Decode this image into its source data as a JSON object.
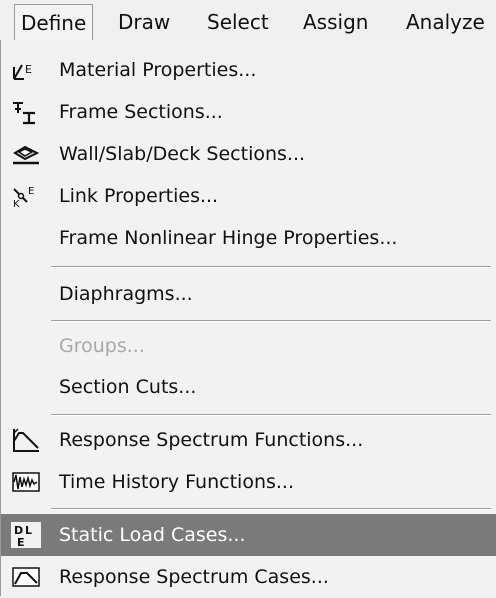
{
  "menubar": {
    "items": [
      {
        "label": "Define"
      },
      {
        "label": "Draw"
      },
      {
        "label": "Select"
      },
      {
        "label": "Assign"
      },
      {
        "label": "Analyze"
      }
    ]
  },
  "menu": {
    "items": [
      {
        "label": "Material Properties...",
        "icon": "material-properties-icon"
      },
      {
        "label": "Frame Sections...",
        "icon": "frame-sections-icon"
      },
      {
        "label": "Wall/Slab/Deck Sections...",
        "icon": "wall-slab-deck-icon"
      },
      {
        "label": "Link Properties...",
        "icon": "link-properties-icon"
      },
      {
        "label": "Frame Nonlinear Hinge Properties..."
      },
      {
        "label": "Diaphragms..."
      },
      {
        "label": "Groups...",
        "state": "disabled"
      },
      {
        "label": "Section Cuts..."
      },
      {
        "label": "Response Spectrum Functions...",
        "icon": "response-spectrum-functions-icon"
      },
      {
        "label": "Time History Functions...",
        "icon": "time-history-functions-icon"
      },
      {
        "label": "Static Load Cases...",
        "icon": "static-load-cases-icon",
        "state": "highlighted"
      },
      {
        "label": "Response Spectrum Cases...",
        "icon": "response-spectrum-cases-icon"
      }
    ]
  },
  "colors": {
    "highlight": "#7a7a7a",
    "background": "#f2f2f2",
    "disabled_text": "#a8a8a8"
  }
}
